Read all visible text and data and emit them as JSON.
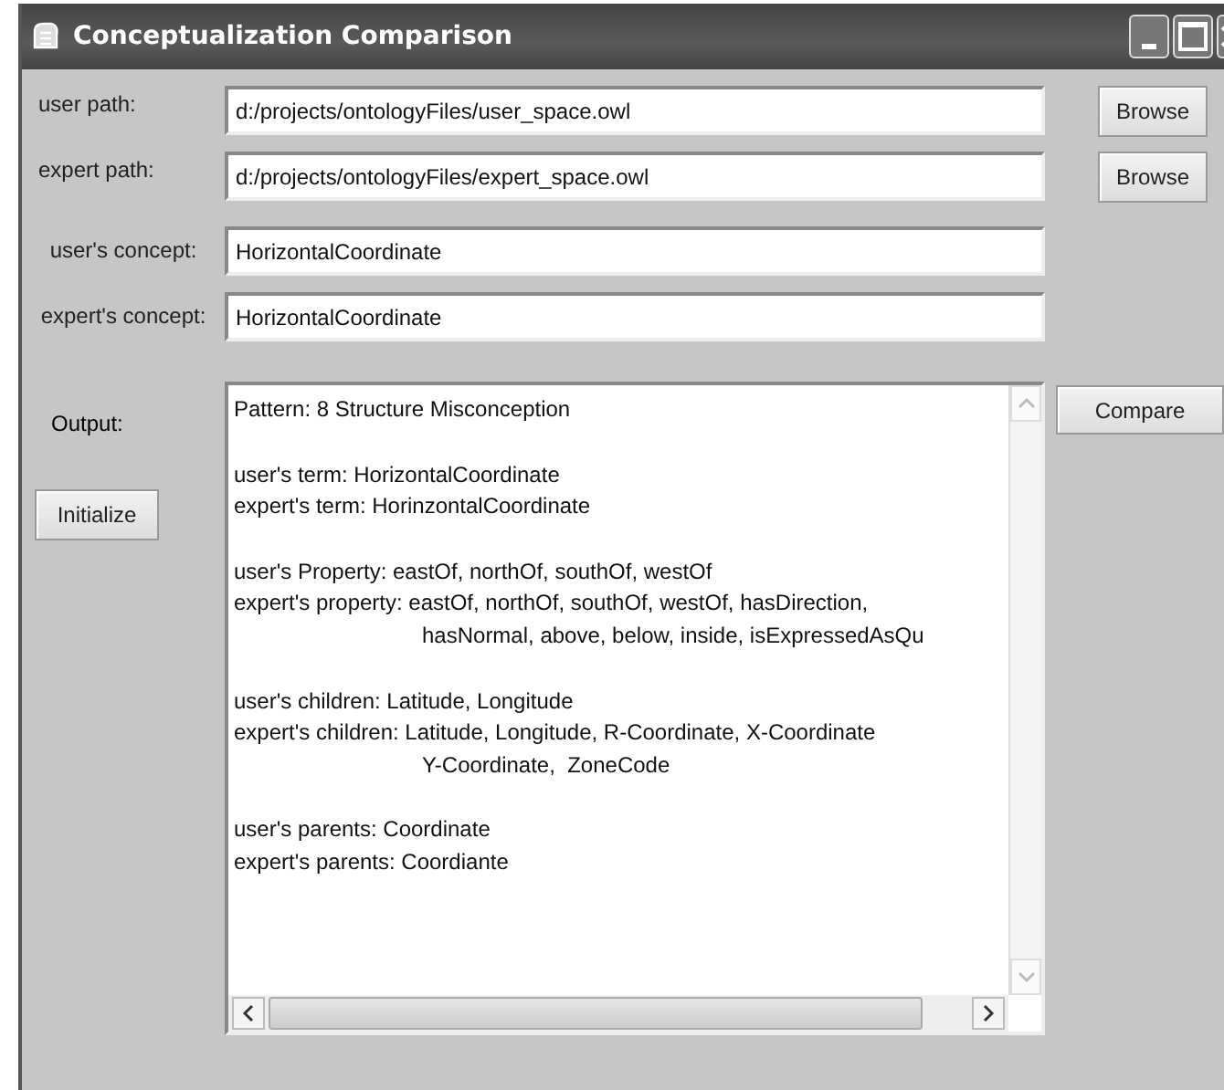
{
  "window": {
    "title": "Conceptualization Comparison"
  },
  "fields": [
    {
      "label": "user path:",
      "value": "d:/projects/ontologyFiles/user_space.owl",
      "button": "Browse"
    },
    {
      "label": "expert path:",
      "value": "d:/projects/ontologyFiles/expert_space.owl",
      "button": "Browse"
    },
    {
      "label": "user's concept:",
      "value": "HorizontalCoordinate"
    },
    {
      "label": "expert's concept:",
      "value": "HorizontalCoordinate"
    }
  ],
  "output": {
    "label": "Output:",
    "sections": [
      [
        {
          "kind": "line",
          "text": "Pattern: 8 Structure Misconception"
        }
      ],
      [
        {
          "kind": "line",
          "text": "user's term: HorizontalCoordinate"
        },
        {
          "kind": "line",
          "text": "expert's term: HorinzontalCoordinate"
        }
      ],
      [
        {
          "kind": "line",
          "text": "user's Property: eastOf, northOf, southOf, westOf"
        },
        {
          "kind": "line",
          "text": "expert's property: eastOf, northOf, southOf, westOf, hasDirection,"
        },
        {
          "kind": "continuation",
          "text": "hasNormal, above, below, inside, isExpressedAsQu"
        }
      ],
      [
        {
          "kind": "line",
          "text": "user's children: Latitude, Longitude"
        },
        {
          "kind": "line",
          "text": "expert's children: Latitude, Longitude, R-Coordinate, X-Coordinate"
        },
        {
          "kind": "continuation",
          "text": "Y-Coordinate,  ZoneCode"
        }
      ],
      [
        {
          "kind": "line",
          "text": "user's parents: Coordinate"
        },
        {
          "kind": "line",
          "text": "expert's parents: Coordiante"
        }
      ]
    ]
  },
  "buttons": {
    "compare": "Compare",
    "initialize": "Initialize"
  }
}
